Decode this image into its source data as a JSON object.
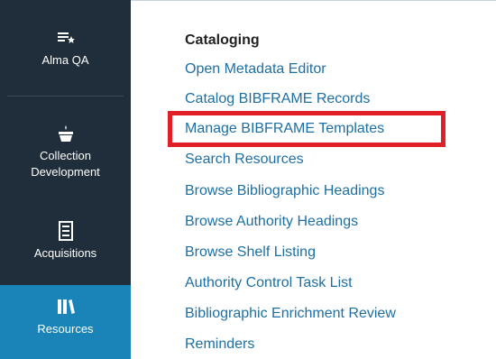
{
  "sidebar": {
    "items": [
      {
        "label": "Alma QA",
        "icon": "list-star-icon"
      },
      {
        "label": "Collection\nDevelopment",
        "icon": "basket-icon"
      },
      {
        "label": "Acquisitions",
        "icon": "ledger-icon"
      },
      {
        "label": "Resources",
        "icon": "books-icon"
      }
    ]
  },
  "panel": {
    "title": "Cataloging",
    "links": [
      "Open Metadata Editor",
      "Catalog BIBFRAME Records",
      "Manage BIBFRAME Templates",
      "Search Resources",
      "Browse Bibliographic Headings",
      "Browse Authority Headings",
      "Browse Shelf Listing",
      "Authority Control Task List",
      "Bibliographic Enrichment Review",
      "Reminders"
    ]
  },
  "colors": {
    "sidebar_bg": "#1f2e3a",
    "active_bg": "#1a83b8",
    "link": "#1d6fa3",
    "highlight": "#e01f26"
  }
}
